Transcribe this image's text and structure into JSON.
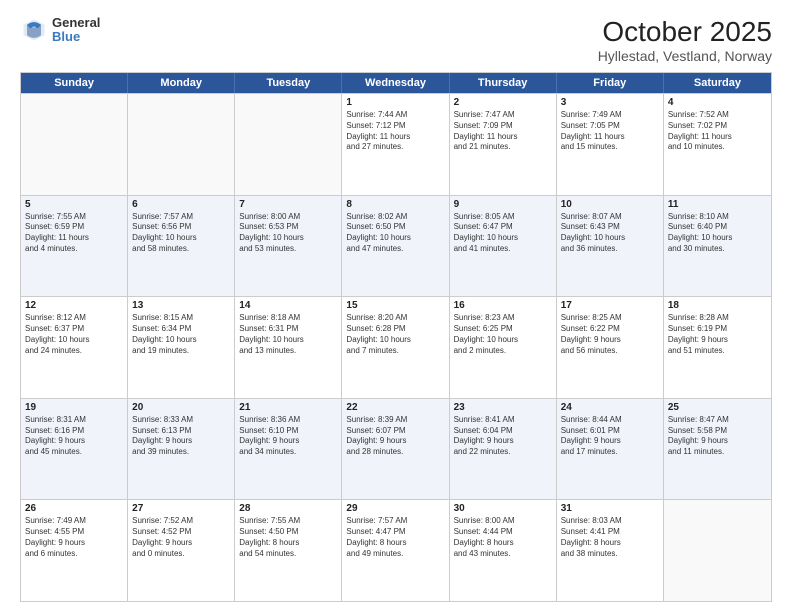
{
  "header": {
    "logo_line1": "General",
    "logo_line2": "Blue",
    "title": "October 2025",
    "subtitle": "Hyllestad, Vestland, Norway"
  },
  "days": [
    "Sunday",
    "Monday",
    "Tuesday",
    "Wednesday",
    "Thursday",
    "Friday",
    "Saturday"
  ],
  "weeks": [
    [
      {
        "date": "",
        "info": ""
      },
      {
        "date": "",
        "info": ""
      },
      {
        "date": "",
        "info": ""
      },
      {
        "date": "1",
        "info": "Sunrise: 7:44 AM\nSunset: 7:12 PM\nDaylight: 11 hours\nand 27 minutes."
      },
      {
        "date": "2",
        "info": "Sunrise: 7:47 AM\nSunset: 7:09 PM\nDaylight: 11 hours\nand 21 minutes."
      },
      {
        "date": "3",
        "info": "Sunrise: 7:49 AM\nSunset: 7:05 PM\nDaylight: 11 hours\nand 15 minutes."
      },
      {
        "date": "4",
        "info": "Sunrise: 7:52 AM\nSunset: 7:02 PM\nDaylight: 11 hours\nand 10 minutes."
      }
    ],
    [
      {
        "date": "5",
        "info": "Sunrise: 7:55 AM\nSunset: 6:59 PM\nDaylight: 11 hours\nand 4 minutes."
      },
      {
        "date": "6",
        "info": "Sunrise: 7:57 AM\nSunset: 6:56 PM\nDaylight: 10 hours\nand 58 minutes."
      },
      {
        "date": "7",
        "info": "Sunrise: 8:00 AM\nSunset: 6:53 PM\nDaylight: 10 hours\nand 53 minutes."
      },
      {
        "date": "8",
        "info": "Sunrise: 8:02 AM\nSunset: 6:50 PM\nDaylight: 10 hours\nand 47 minutes."
      },
      {
        "date": "9",
        "info": "Sunrise: 8:05 AM\nSunset: 6:47 PM\nDaylight: 10 hours\nand 41 minutes."
      },
      {
        "date": "10",
        "info": "Sunrise: 8:07 AM\nSunset: 6:43 PM\nDaylight: 10 hours\nand 36 minutes."
      },
      {
        "date": "11",
        "info": "Sunrise: 8:10 AM\nSunset: 6:40 PM\nDaylight: 10 hours\nand 30 minutes."
      }
    ],
    [
      {
        "date": "12",
        "info": "Sunrise: 8:12 AM\nSunset: 6:37 PM\nDaylight: 10 hours\nand 24 minutes."
      },
      {
        "date": "13",
        "info": "Sunrise: 8:15 AM\nSunset: 6:34 PM\nDaylight: 10 hours\nand 19 minutes."
      },
      {
        "date": "14",
        "info": "Sunrise: 8:18 AM\nSunset: 6:31 PM\nDaylight: 10 hours\nand 13 minutes."
      },
      {
        "date": "15",
        "info": "Sunrise: 8:20 AM\nSunset: 6:28 PM\nDaylight: 10 hours\nand 7 minutes."
      },
      {
        "date": "16",
        "info": "Sunrise: 8:23 AM\nSunset: 6:25 PM\nDaylight: 10 hours\nand 2 minutes."
      },
      {
        "date": "17",
        "info": "Sunrise: 8:25 AM\nSunset: 6:22 PM\nDaylight: 9 hours\nand 56 minutes."
      },
      {
        "date": "18",
        "info": "Sunrise: 8:28 AM\nSunset: 6:19 PM\nDaylight: 9 hours\nand 51 minutes."
      }
    ],
    [
      {
        "date": "19",
        "info": "Sunrise: 8:31 AM\nSunset: 6:16 PM\nDaylight: 9 hours\nand 45 minutes."
      },
      {
        "date": "20",
        "info": "Sunrise: 8:33 AM\nSunset: 6:13 PM\nDaylight: 9 hours\nand 39 minutes."
      },
      {
        "date": "21",
        "info": "Sunrise: 8:36 AM\nSunset: 6:10 PM\nDaylight: 9 hours\nand 34 minutes."
      },
      {
        "date": "22",
        "info": "Sunrise: 8:39 AM\nSunset: 6:07 PM\nDaylight: 9 hours\nand 28 minutes."
      },
      {
        "date": "23",
        "info": "Sunrise: 8:41 AM\nSunset: 6:04 PM\nDaylight: 9 hours\nand 22 minutes."
      },
      {
        "date": "24",
        "info": "Sunrise: 8:44 AM\nSunset: 6:01 PM\nDaylight: 9 hours\nand 17 minutes."
      },
      {
        "date": "25",
        "info": "Sunrise: 8:47 AM\nSunset: 5:58 PM\nDaylight: 9 hours\nand 11 minutes."
      }
    ],
    [
      {
        "date": "26",
        "info": "Sunrise: 7:49 AM\nSunset: 4:55 PM\nDaylight: 9 hours\nand 6 minutes."
      },
      {
        "date": "27",
        "info": "Sunrise: 7:52 AM\nSunset: 4:52 PM\nDaylight: 9 hours\nand 0 minutes."
      },
      {
        "date": "28",
        "info": "Sunrise: 7:55 AM\nSunset: 4:50 PM\nDaylight: 8 hours\nand 54 minutes."
      },
      {
        "date": "29",
        "info": "Sunrise: 7:57 AM\nSunset: 4:47 PM\nDaylight: 8 hours\nand 49 minutes."
      },
      {
        "date": "30",
        "info": "Sunrise: 8:00 AM\nSunset: 4:44 PM\nDaylight: 8 hours\nand 43 minutes."
      },
      {
        "date": "31",
        "info": "Sunrise: 8:03 AM\nSunset: 4:41 PM\nDaylight: 8 hours\nand 38 minutes."
      },
      {
        "date": "",
        "info": ""
      }
    ]
  ]
}
